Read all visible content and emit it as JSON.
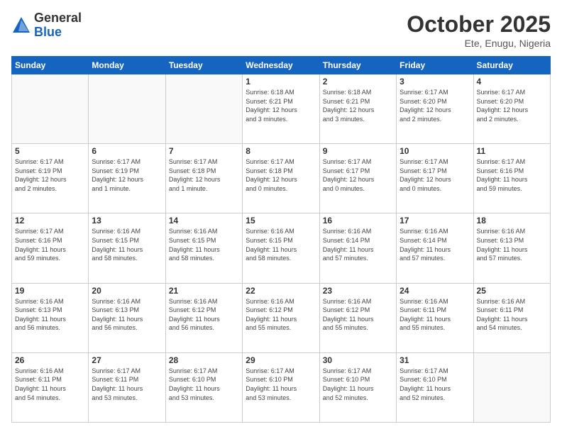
{
  "logo": {
    "general": "General",
    "blue": "Blue"
  },
  "header": {
    "month": "October 2025",
    "location": "Ete, Enugu, Nigeria"
  },
  "weekdays": [
    "Sunday",
    "Monday",
    "Tuesday",
    "Wednesday",
    "Thursday",
    "Friday",
    "Saturday"
  ],
  "weeks": [
    [
      {
        "day": "",
        "info": ""
      },
      {
        "day": "",
        "info": ""
      },
      {
        "day": "",
        "info": ""
      },
      {
        "day": "1",
        "info": "Sunrise: 6:18 AM\nSunset: 6:21 PM\nDaylight: 12 hours\nand 3 minutes."
      },
      {
        "day": "2",
        "info": "Sunrise: 6:18 AM\nSunset: 6:21 PM\nDaylight: 12 hours\nand 3 minutes."
      },
      {
        "day": "3",
        "info": "Sunrise: 6:17 AM\nSunset: 6:20 PM\nDaylight: 12 hours\nand 2 minutes."
      },
      {
        "day": "4",
        "info": "Sunrise: 6:17 AM\nSunset: 6:20 PM\nDaylight: 12 hours\nand 2 minutes."
      }
    ],
    [
      {
        "day": "5",
        "info": "Sunrise: 6:17 AM\nSunset: 6:19 PM\nDaylight: 12 hours\nand 2 minutes."
      },
      {
        "day": "6",
        "info": "Sunrise: 6:17 AM\nSunset: 6:19 PM\nDaylight: 12 hours\nand 1 minute."
      },
      {
        "day": "7",
        "info": "Sunrise: 6:17 AM\nSunset: 6:18 PM\nDaylight: 12 hours\nand 1 minute."
      },
      {
        "day": "8",
        "info": "Sunrise: 6:17 AM\nSunset: 6:18 PM\nDaylight: 12 hours\nand 0 minutes."
      },
      {
        "day": "9",
        "info": "Sunrise: 6:17 AM\nSunset: 6:17 PM\nDaylight: 12 hours\nand 0 minutes."
      },
      {
        "day": "10",
        "info": "Sunrise: 6:17 AM\nSunset: 6:17 PM\nDaylight: 12 hours\nand 0 minutes."
      },
      {
        "day": "11",
        "info": "Sunrise: 6:17 AM\nSunset: 6:16 PM\nDaylight: 11 hours\nand 59 minutes."
      }
    ],
    [
      {
        "day": "12",
        "info": "Sunrise: 6:17 AM\nSunset: 6:16 PM\nDaylight: 11 hours\nand 59 minutes."
      },
      {
        "day": "13",
        "info": "Sunrise: 6:16 AM\nSunset: 6:15 PM\nDaylight: 11 hours\nand 58 minutes."
      },
      {
        "day": "14",
        "info": "Sunrise: 6:16 AM\nSunset: 6:15 PM\nDaylight: 11 hours\nand 58 minutes."
      },
      {
        "day": "15",
        "info": "Sunrise: 6:16 AM\nSunset: 6:15 PM\nDaylight: 11 hours\nand 58 minutes."
      },
      {
        "day": "16",
        "info": "Sunrise: 6:16 AM\nSunset: 6:14 PM\nDaylight: 11 hours\nand 57 minutes."
      },
      {
        "day": "17",
        "info": "Sunrise: 6:16 AM\nSunset: 6:14 PM\nDaylight: 11 hours\nand 57 minutes."
      },
      {
        "day": "18",
        "info": "Sunrise: 6:16 AM\nSunset: 6:13 PM\nDaylight: 11 hours\nand 57 minutes."
      }
    ],
    [
      {
        "day": "19",
        "info": "Sunrise: 6:16 AM\nSunset: 6:13 PM\nDaylight: 11 hours\nand 56 minutes."
      },
      {
        "day": "20",
        "info": "Sunrise: 6:16 AM\nSunset: 6:13 PM\nDaylight: 11 hours\nand 56 minutes."
      },
      {
        "day": "21",
        "info": "Sunrise: 6:16 AM\nSunset: 6:12 PM\nDaylight: 11 hours\nand 56 minutes."
      },
      {
        "day": "22",
        "info": "Sunrise: 6:16 AM\nSunset: 6:12 PM\nDaylight: 11 hours\nand 55 minutes."
      },
      {
        "day": "23",
        "info": "Sunrise: 6:16 AM\nSunset: 6:12 PM\nDaylight: 11 hours\nand 55 minutes."
      },
      {
        "day": "24",
        "info": "Sunrise: 6:16 AM\nSunset: 6:11 PM\nDaylight: 11 hours\nand 55 minutes."
      },
      {
        "day": "25",
        "info": "Sunrise: 6:16 AM\nSunset: 6:11 PM\nDaylight: 11 hours\nand 54 minutes."
      }
    ],
    [
      {
        "day": "26",
        "info": "Sunrise: 6:16 AM\nSunset: 6:11 PM\nDaylight: 11 hours\nand 54 minutes."
      },
      {
        "day": "27",
        "info": "Sunrise: 6:17 AM\nSunset: 6:11 PM\nDaylight: 11 hours\nand 53 minutes."
      },
      {
        "day": "28",
        "info": "Sunrise: 6:17 AM\nSunset: 6:10 PM\nDaylight: 11 hours\nand 53 minutes."
      },
      {
        "day": "29",
        "info": "Sunrise: 6:17 AM\nSunset: 6:10 PM\nDaylight: 11 hours\nand 53 minutes."
      },
      {
        "day": "30",
        "info": "Sunrise: 6:17 AM\nSunset: 6:10 PM\nDaylight: 11 hours\nand 52 minutes."
      },
      {
        "day": "31",
        "info": "Sunrise: 6:17 AM\nSunset: 6:10 PM\nDaylight: 11 hours\nand 52 minutes."
      },
      {
        "day": "",
        "info": ""
      }
    ]
  ]
}
